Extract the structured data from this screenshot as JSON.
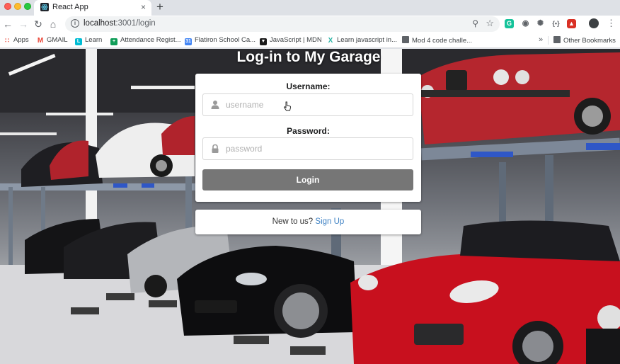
{
  "browser": {
    "tab_title": "React App",
    "tab_close": "×",
    "new_tab": "+",
    "url_host": "localhost",
    "url_rest": ":3001/login",
    "icons": {
      "back": "arrow-left-icon",
      "forward": "arrow-right-icon",
      "reload": "reload-icon",
      "home": "home-icon",
      "info": "info-icon",
      "zoom": "zoom-icon",
      "star": "star-icon",
      "menu": "more-vert-icon"
    }
  },
  "bookmarks": {
    "items": [
      {
        "label": "Apps",
        "icon": "apps-grid-icon",
        "color": "#ea4335"
      },
      {
        "label": "GMAIL",
        "icon": "gmail-icon",
        "color": "#ea4335"
      },
      {
        "label": "Learn",
        "icon": "learn-icon",
        "color": "#00bcd4"
      },
      {
        "label": "Attendance Regist...",
        "icon": "attendance-icon",
        "color": "#0f9d58"
      },
      {
        "label": "Flatiron School Ca...",
        "icon": "calendar-icon",
        "color": "#4285f4"
      },
      {
        "label": "JavaScript | MDN",
        "icon": "mdn-icon",
        "color": "#1a1a1a"
      },
      {
        "label": "Learn javascript in...",
        "icon": "scrimba-icon",
        "color": "#2bb5a6"
      },
      {
        "label": "Mod 4 code challe...",
        "icon": "folder-icon",
        "color": "#5f6368"
      }
    ],
    "overflow": "»",
    "other": "Other Bookmarks"
  },
  "page": {
    "title": "Log-in to My Garage",
    "username_label": "Username:",
    "username_placeholder": "username",
    "password_label": "Password:",
    "password_placeholder": "password",
    "login_button": "Login",
    "signup_prompt": "New to us?",
    "signup_link": "Sign Up"
  },
  "colors": {
    "login_button": "#767676",
    "link": "#4183c4",
    "tab_strip": "#dee1e6"
  }
}
